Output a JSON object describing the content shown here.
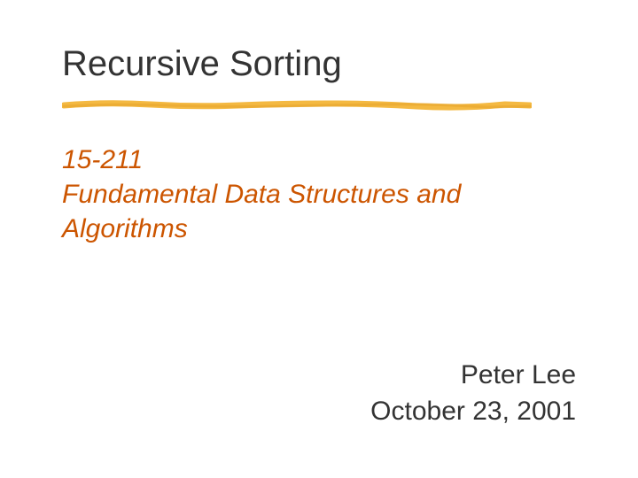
{
  "title": "Recursive Sorting",
  "subtitle_line1": "15-211",
  "subtitle_line2": "Fundamental Data Structures and Algorithms",
  "author": "Peter Lee",
  "date": "October 23, 2001"
}
